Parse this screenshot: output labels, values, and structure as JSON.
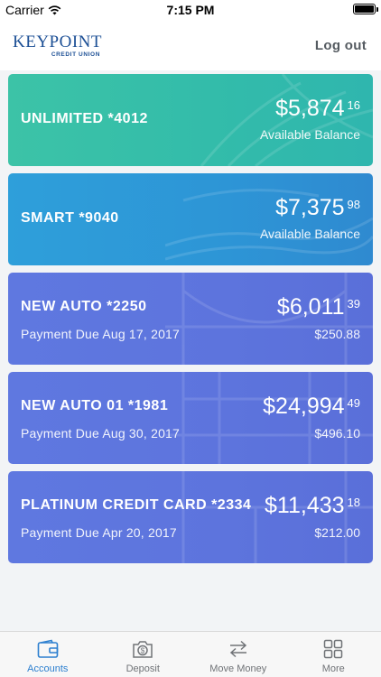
{
  "status_bar": {
    "carrier": "Carrier",
    "time": "7:15 PM"
  },
  "header": {
    "logo_text": "KEYPOINT",
    "logo_sub": "CREDIT UNION",
    "logout_label": "Log out"
  },
  "accounts": [
    {
      "name": "UNLIMITED *4012",
      "amount": "$5,874",
      "cents": "16",
      "sub_label": "Available Balance",
      "color": "#3cc3a7"
    },
    {
      "name": "SMART *9040",
      "amount": "$7,375",
      "cents": "98",
      "sub_label": "Available Balance",
      "color": "#2e9fda"
    },
    {
      "name": "NEW AUTO *2250",
      "amount": "$6,011",
      "cents": "39",
      "due": "Payment Due Aug 17, 2017",
      "sub_label": "$250.88",
      "color": "#5f78e0"
    },
    {
      "name": "NEW AUTO 01 *1981",
      "amount": "$24,994",
      "cents": "49",
      "due": "Payment Due Aug 30, 2017",
      "sub_label": "$496.10",
      "color": "#5f78e0"
    },
    {
      "name": "PLATINUM CREDIT CARD *2334",
      "amount": "$11,433",
      "cents": "18",
      "due": "Payment Due Apr 20, 2017",
      "sub_label": "$212.00",
      "color": "#5f78e0"
    }
  ],
  "tabbar": {
    "tabs": [
      {
        "label": "Accounts",
        "icon": "wallet-icon",
        "active": true
      },
      {
        "label": "Deposit",
        "icon": "camera-dollar-icon",
        "active": false
      },
      {
        "label": "Move Money",
        "icon": "transfer-arrows-icon",
        "active": false
      },
      {
        "label": "More",
        "icon": "grid-icon",
        "active": false
      }
    ]
  },
  "colors": {
    "accent": "#2c7fcf",
    "brand": "#1c4f95",
    "teal_card": "#3cc3a7",
    "blue_card": "#2e9fda",
    "indigo_card": "#5f78e0"
  }
}
